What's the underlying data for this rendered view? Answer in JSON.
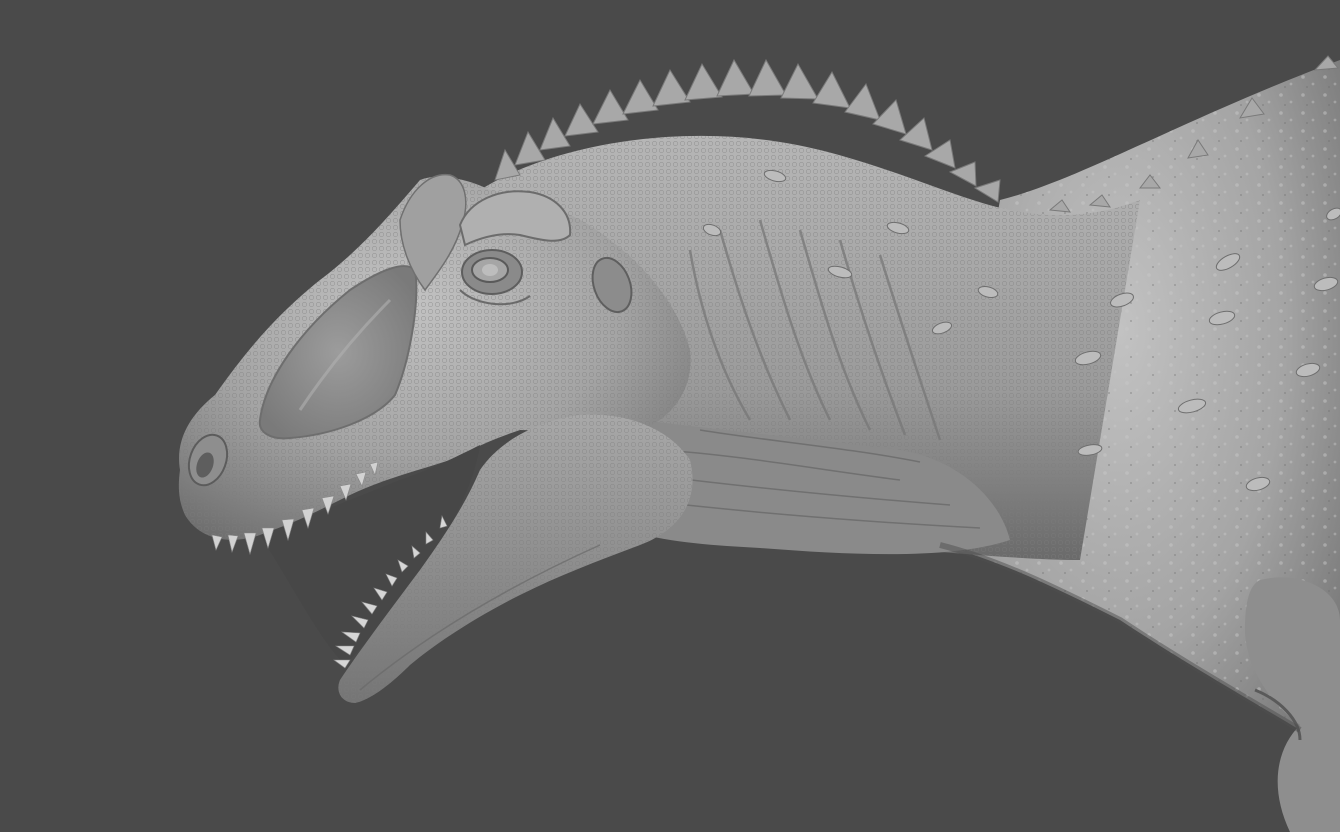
{
  "scene": {
    "subject": "dinosaur-head-sculpt",
    "colors": {
      "background": "#4a4a4a",
      "clay_light": "#b4b4b4",
      "clay_mid": "#8c8c8c",
      "clay_dark": "#5e5e5e",
      "mouth_shadow": "#3c3c3c",
      "teeth": "#d6d6d6"
    }
  }
}
